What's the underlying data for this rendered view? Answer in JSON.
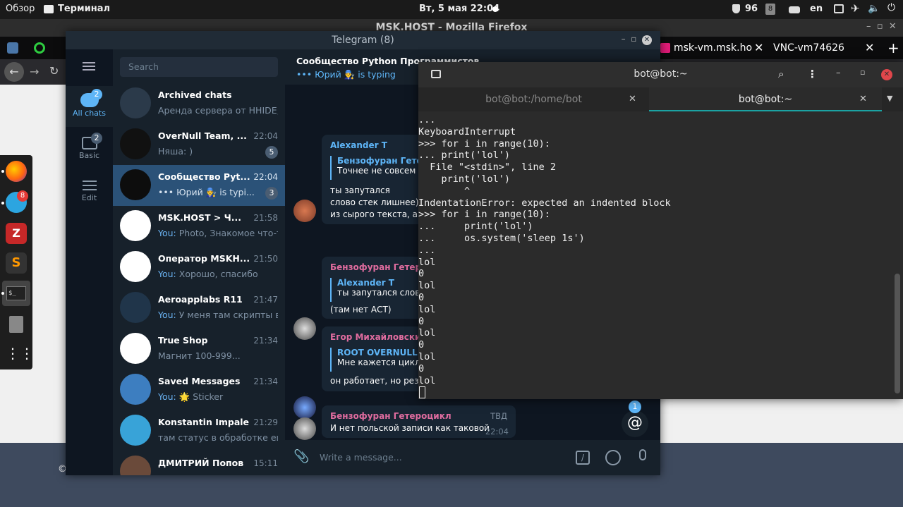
{
  "topbar": {
    "overview": "Обзор",
    "terminal_app": "Терминал",
    "datetime": "Вт, 5 мая  22:04",
    "battery": "96",
    "workspace": "8",
    "lang": "en"
  },
  "firefox": {
    "title": "MSK.HOST - Mozilla Firefox",
    "tab_vm": "msk-vm.msk.ho",
    "tab_vnc": "VNC-vm74626",
    "footer_char": "©"
  },
  "dock": {
    "telegram_badge": "8"
  },
  "telegram": {
    "window_title": "Telegram (8)",
    "search_placeholder": "Search",
    "folders": [
      {
        "label": "All chats",
        "badge": "2"
      },
      {
        "label": "Basic",
        "badge": "2"
      },
      {
        "label": "Edit"
      }
    ],
    "chats": [
      {
        "name": "Archived chats",
        "time": "",
        "preview": "Аренда сервера от HHIDE, ...",
        "badge": ""
      },
      {
        "name": "OverNull Team, ...",
        "time": "22:04",
        "preview": "Няша: )",
        "badge": "5"
      },
      {
        "name": "Сообщество Pyt...",
        "time": "22:04",
        "preview": "••• Юрий 👨‍🔧 is typi...",
        "badge": "3"
      },
      {
        "name": "MSK.HOST > Ч...",
        "time": "21:58",
        "you": "You:",
        "preview": "Photo, Знакомое что-то)",
        "badge": ""
      },
      {
        "name": "Оператор MSKH...",
        "time": "21:50",
        "you": "You:",
        "preview": "Хорошо, спасибо",
        "badge": ""
      },
      {
        "name": "Aeroapplabs R11",
        "time": "21:47",
        "you": "You:",
        "preview": "У меня там скрипты в...",
        "badge": ""
      },
      {
        "name": "True Shop",
        "time": "21:34",
        "preview": "Магнит 100-999...",
        "badge": ""
      },
      {
        "name": "Saved Messages",
        "time": "21:34",
        "you": "You:",
        "preview": "🌟 Sticker",
        "badge": ""
      },
      {
        "name": "Konstantin Impaler",
        "time": "21:29",
        "preview": "там статус в обработке еще",
        "badge": ""
      },
      {
        "name": "ДМИТРИЙ Попов",
        "time": "15:11",
        "preview": "",
        "badge": ""
      }
    ],
    "conversation": {
      "title": "Сообщество Python Программистов",
      "status": "••• Юрий 👨‍🔧 is typing",
      "messages": [
        {
          "sender": "Alexander T",
          "reply_name": "Бензофуран Гетеро",
          "reply_text": "Точнее не совсем С",
          "lines": [
            "ты запутался",
            "слово стек лишнее) т",
            "из сырого текста, а в"
          ]
        },
        {
          "sender": "Бензофуран Гетероц",
          "reply_name": "Alexander T",
          "reply_text": "ты запутался слово",
          "lines": [
            "(там нет АСТ)"
          ]
        },
        {
          "sender": "Егор Михайловский",
          "reply_name": "ROOT OVERNULL.RU",
          "reply_text": "Мне кажется цикл г",
          "lines": [
            "он работает, но резу"
          ]
        },
        {
          "sender": "Бензофуран Гетероцикл",
          "tag": "ТВД",
          "lines": [
            "И нет польской записи как таковой"
          ],
          "time": "22:04"
        }
      ],
      "mention_badge": "1",
      "compose_placeholder": "Write a message..."
    }
  },
  "terminal": {
    "title": "bot@bot:~",
    "tabs": [
      {
        "label": "bot@bot:/home/bot",
        "active": false
      },
      {
        "label": "bot@bot:~",
        "active": true
      }
    ],
    "output": "...\nKeyboardInterrupt\n>>> for i in range(10):\n... print('lol')\n  File \"<stdin>\", line 2\n    print('lol')\n        ^\nIndentationError: expected an indented block\n>>> for i in range(10):\n...     print('lol')\n...     os.system('sleep 1s')\n...\nlol\n0\nlol\n0\nlol\n0\nlol\n0\nlol\n0\nlol"
  }
}
